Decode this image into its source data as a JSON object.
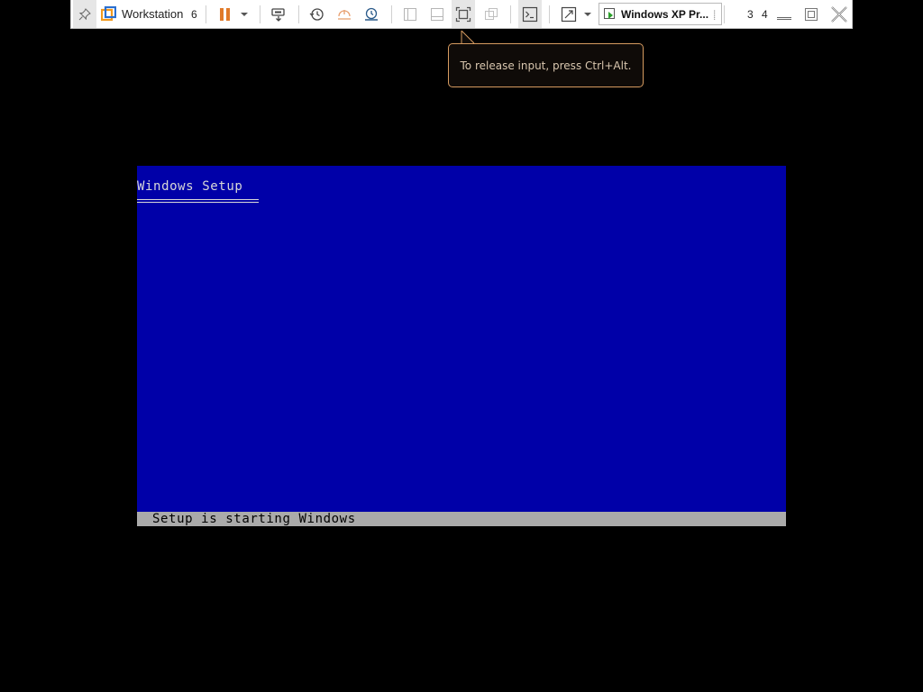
{
  "toolbar": {
    "pin_icon": "pin-icon",
    "app_name": "Workstation",
    "app_version": "6",
    "vm_tab_label": "Windows XP Pr...",
    "vm_numbers": "3 4",
    "colors": {
      "pause": "#e07a2a",
      "vmware_orange": "#f39a1e",
      "vmware_blue": "#2a6fd0"
    }
  },
  "tooltip": {
    "text": "To release input, press Ctrl+Alt."
  },
  "guest": {
    "title": "Windows Setup",
    "status": "Setup is starting Windows",
    "colors": {
      "background": "#0000a8",
      "status_bar": "#aaaaaa",
      "text": "#d8d8d8"
    }
  }
}
